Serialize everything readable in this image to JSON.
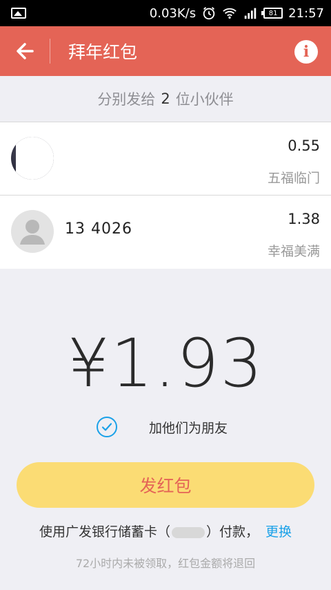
{
  "status_bar": {
    "speed": "0.03K/s",
    "battery": "81",
    "time": "21:57"
  },
  "header": {
    "title": "拜年红包"
  },
  "summary": {
    "prefix": "分别发给",
    "count": "2",
    "suffix": "位小伙伴"
  },
  "recipients": [
    {
      "name": "",
      "amount": "0.55",
      "blessing": "五福临门"
    },
    {
      "name": "13    4026",
      "amount": "1.38",
      "blessing": "幸福美满"
    }
  ],
  "total": "¥1.93",
  "friend_option": {
    "label": "加他们为朋友",
    "checked": true
  },
  "send_button": {
    "label": "发红包"
  },
  "payment": {
    "prefix": "使用广发银行储蓄卡（",
    "suffix": "）付款，",
    "change_label": "更换"
  },
  "note": "72小时内未被领取，红包金额将退回",
  "colors": {
    "header": "#e46456",
    "button": "#fbdc74",
    "link": "#1aa1e8"
  }
}
